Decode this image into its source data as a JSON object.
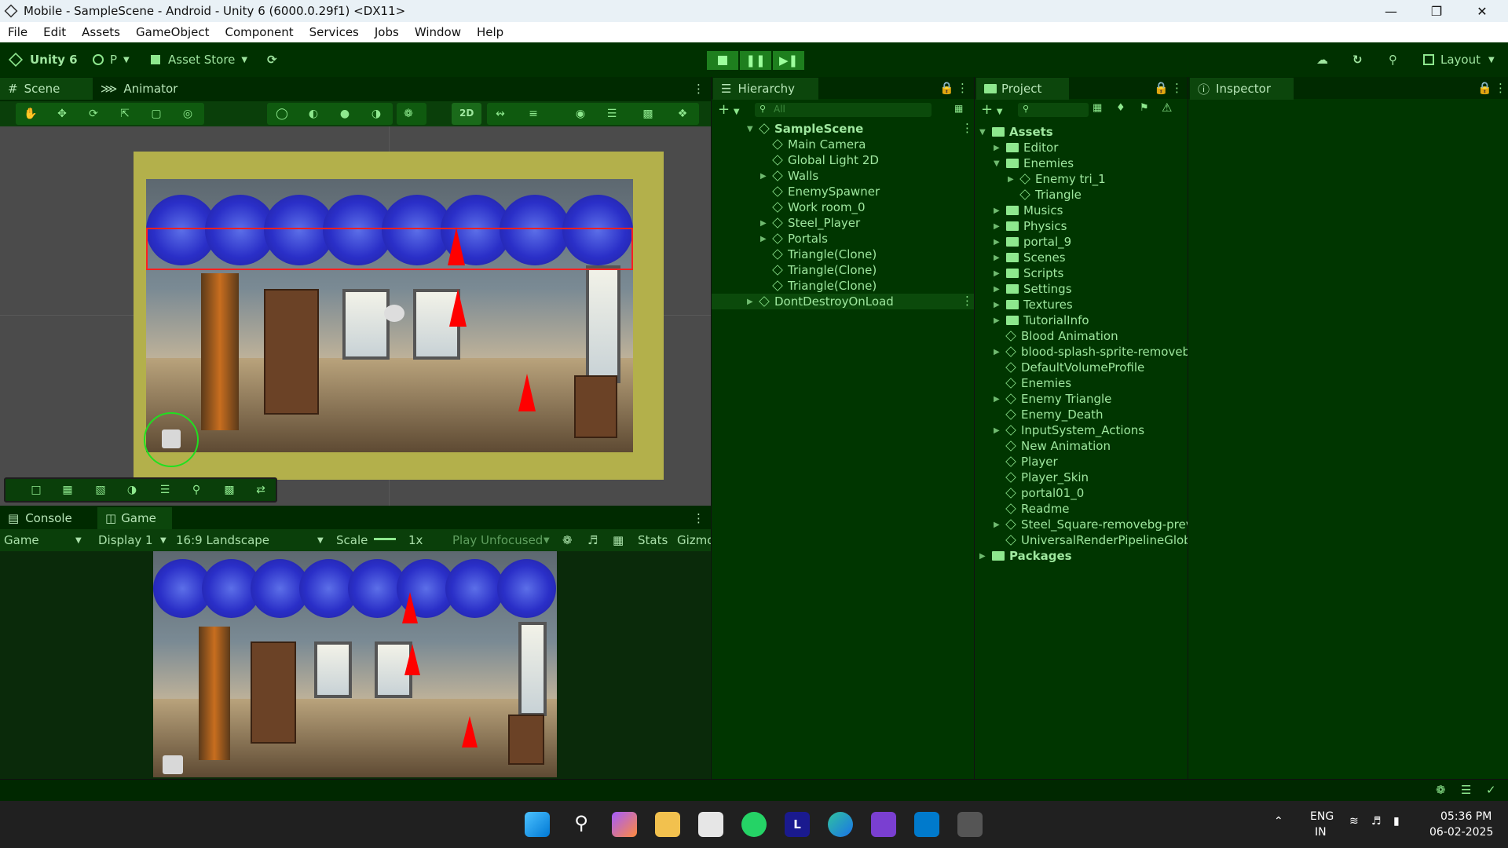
{
  "window": {
    "title": "Mobile - SampleScene - Android - Unity 6 (6000.0.29f1) <DX11>"
  },
  "menu": [
    "File",
    "Edit",
    "Assets",
    "GameObject",
    "Component",
    "Services",
    "Jobs",
    "Window",
    "Help"
  ],
  "toolbar": {
    "unity_label": "Unity 6",
    "account_label": "P",
    "asset_store_label": "Asset Store",
    "layout_label": "Layout"
  },
  "scene_tabs": {
    "scene": "Scene",
    "animator": "Animator",
    "mode_2d": "2D"
  },
  "game_tabs": {
    "console": "Console",
    "game": "Game"
  },
  "game_toolbar": {
    "view_select": "Game",
    "display_select": "Display 1",
    "aspect_select": "16:9 Landscape",
    "scale_label": "Scale",
    "scale_value": "1x",
    "play_focus": "Play Unfocused",
    "stats_label": "Stats",
    "gizmos_label": "Gizmo"
  },
  "hierarchy": {
    "tab": "Hierarchy",
    "search_placeholder": "All",
    "scene_name": "SampleScene",
    "items": [
      {
        "label": "Main Camera",
        "arrow": ""
      },
      {
        "label": "Global Light 2D",
        "arrow": ""
      },
      {
        "label": "Walls",
        "arrow": "▶"
      },
      {
        "label": "EnemySpawner",
        "arrow": ""
      },
      {
        "label": "Work room_0",
        "arrow": ""
      },
      {
        "label": "Steel_Player",
        "arrow": "▶"
      },
      {
        "label": "Portals",
        "arrow": "▶"
      },
      {
        "label": "Triangle(Clone)",
        "arrow": ""
      },
      {
        "label": "Triangle(Clone)",
        "arrow": ""
      },
      {
        "label": "Triangle(Clone)",
        "arrow": ""
      }
    ],
    "dont_destroy": "DontDestroyOnLoad"
  },
  "project": {
    "tab": "Project",
    "assets_root": "Assets",
    "items": [
      {
        "label": "Editor",
        "indent": 1,
        "type": "folder",
        "arrow": "▶"
      },
      {
        "label": "Enemies",
        "indent": 1,
        "type": "folder",
        "arrow": "▼"
      },
      {
        "label": "Enemy tri_1",
        "indent": 2,
        "type": "file",
        "arrow": "▶"
      },
      {
        "label": "Triangle",
        "indent": 2,
        "type": "cube",
        "arrow": ""
      },
      {
        "label": "Musics",
        "indent": 1,
        "type": "folder",
        "arrow": "▶"
      },
      {
        "label": "Physics",
        "indent": 1,
        "type": "folder",
        "arrow": "▶"
      },
      {
        "label": "portal_9",
        "indent": 1,
        "type": "folder",
        "arrow": "▶"
      },
      {
        "label": "Scenes",
        "indent": 1,
        "type": "folder",
        "arrow": "▶"
      },
      {
        "label": "Scripts",
        "indent": 1,
        "type": "folder",
        "arrow": "▶"
      },
      {
        "label": "Settings",
        "indent": 1,
        "type": "folder",
        "arrow": "▶"
      },
      {
        "label": "Textures",
        "indent": 1,
        "type": "folder",
        "arrow": "▶"
      },
      {
        "label": "TutorialInfo",
        "indent": 1,
        "type": "folder",
        "arrow": "▶"
      },
      {
        "label": "Blood Animation",
        "indent": 1,
        "type": "file",
        "arrow": ""
      },
      {
        "label": "blood-splash-sprite-removeb",
        "indent": 1,
        "type": "file",
        "arrow": "▶"
      },
      {
        "label": "DefaultVolumeProfile",
        "indent": 1,
        "type": "cube",
        "arrow": ""
      },
      {
        "label": "Enemies",
        "indent": 1,
        "type": "cube",
        "arrow": ""
      },
      {
        "label": "Enemy Triangle",
        "indent": 1,
        "type": "file",
        "arrow": "▶"
      },
      {
        "label": "Enemy_Death",
        "indent": 1,
        "type": "file",
        "arrow": ""
      },
      {
        "label": "InputSystem_Actions",
        "indent": 1,
        "type": "file",
        "arrow": "▶"
      },
      {
        "label": "New Animation",
        "indent": 1,
        "type": "file",
        "arrow": ""
      },
      {
        "label": "Player",
        "indent": 1,
        "type": "cube",
        "arrow": ""
      },
      {
        "label": "Player_Skin",
        "indent": 1,
        "type": "file",
        "arrow": ""
      },
      {
        "label": "portal01_0",
        "indent": 1,
        "type": "file",
        "arrow": ""
      },
      {
        "label": "Readme",
        "indent": 1,
        "type": "file",
        "arrow": ""
      },
      {
        "label": "Steel_Square-removebg-prev",
        "indent": 1,
        "type": "file",
        "arrow": "▶"
      },
      {
        "label": "UniversalRenderPipelineGloba",
        "indent": 1,
        "type": "cube",
        "arrow": ""
      }
    ],
    "packages": "Packages"
  },
  "inspector": {
    "tab": "Inspector"
  },
  "taskbar": {
    "lang_top": "ENG",
    "lang_bottom": "IN",
    "time": "05:36 PM",
    "date": "06-02-2025"
  },
  "colors": {
    "editor_bg": "#003600",
    "accent": "#8ee88e",
    "scene_frame": "#b3b04b",
    "enemy_red": "#ff0000"
  }
}
